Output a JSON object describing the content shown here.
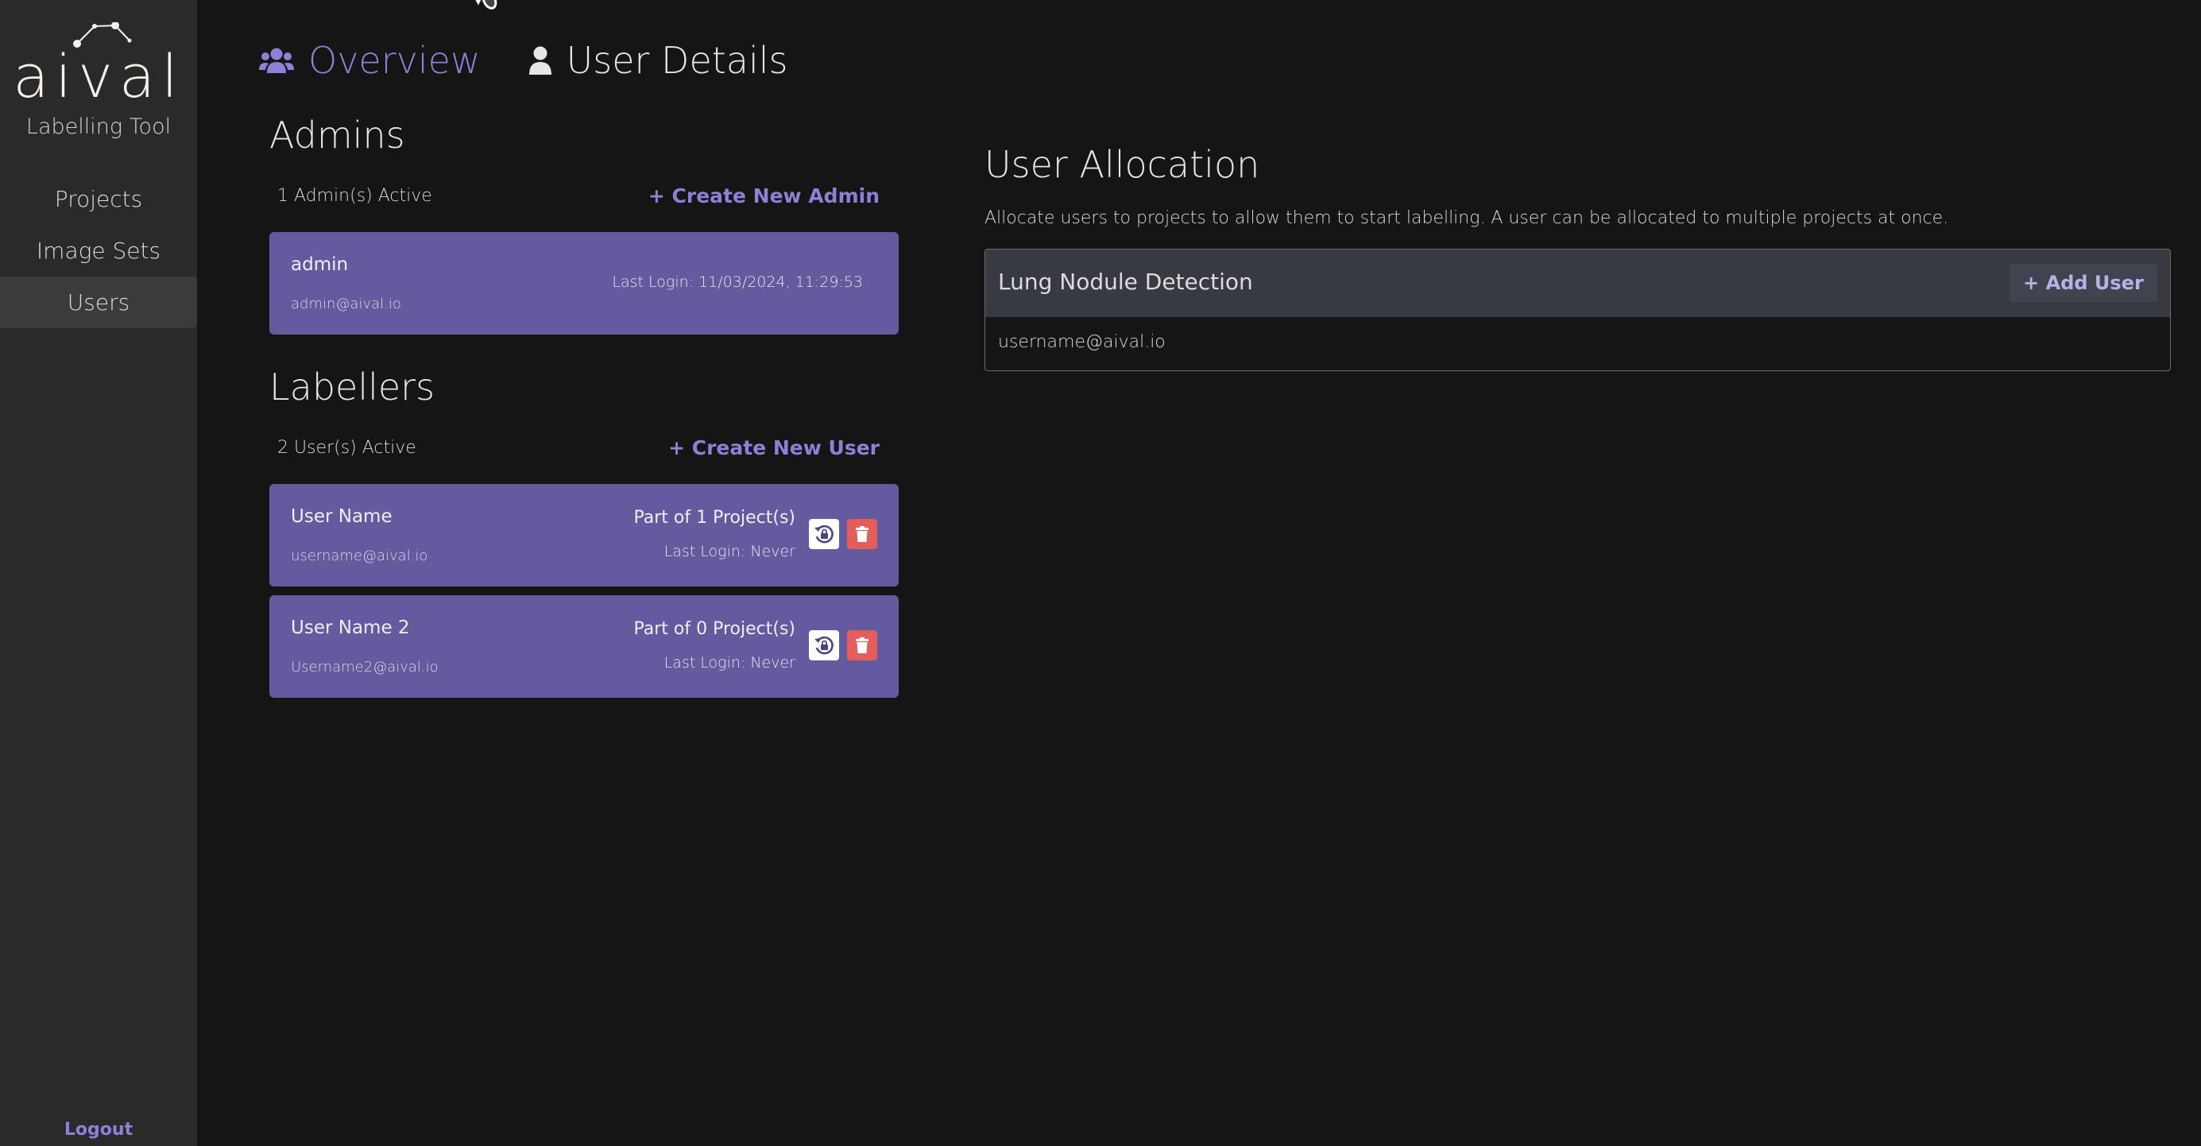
{
  "brand": {
    "logo_text": "aival",
    "subtitle": "Labelling Tool"
  },
  "sidebar": {
    "items": [
      {
        "label": "Projects",
        "active": false
      },
      {
        "label": "Image Sets",
        "active": false
      },
      {
        "label": "Users",
        "active": true
      }
    ],
    "logout_label": "Logout"
  },
  "tabs": [
    {
      "label": "Overview",
      "icon": "users-icon",
      "active": true
    },
    {
      "label": "User Details",
      "icon": "user-icon",
      "active": false
    }
  ],
  "admins": {
    "title": "Admins",
    "count_text": "1 Admin(s) Active",
    "create_label": "+ Create New Admin",
    "items": [
      {
        "name": "admin",
        "email": "admin@aival.io",
        "last_login": "Last Login: 11/03/2024, 11:29:53"
      }
    ]
  },
  "labellers": {
    "title": "Labellers",
    "count_text": "2 User(s) Active",
    "create_label": "+ Create New User",
    "items": [
      {
        "name": "User Name",
        "email": "username@aival.io",
        "projects": "Part of 1 Project(s)",
        "last_login": "Last Login: Never"
      },
      {
        "name": "User Name 2",
        "email": "Username2@aival.io",
        "projects": "Part of 0 Project(s)",
        "last_login": "Last Login: Never"
      }
    ]
  },
  "allocation": {
    "title": "User Allocation",
    "description": "Allocate users to projects to allow them to start labelling. A user can be allocated to multiple projects at once.",
    "projects": [
      {
        "name": "Lung Nodule Detection",
        "add_label": "+ Add User",
        "users": [
          "username@aival.io"
        ]
      }
    ]
  },
  "colors": {
    "accent": "#8a82d6",
    "card": "#635b9e",
    "danger": "#e35d5b",
    "sidebar": "#2a2a2a",
    "background": "#151515"
  }
}
